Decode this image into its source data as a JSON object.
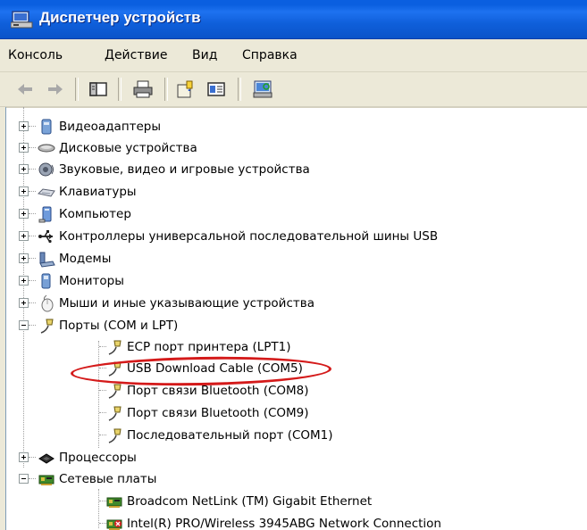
{
  "window": {
    "title": "Диспетчер устройств",
    "icon": "device-manager-icon"
  },
  "menu": {
    "items": [
      "Консоль",
      "Действие",
      "Вид",
      "Справка"
    ]
  },
  "toolbar": {
    "buttons": [
      "back-arrow-icon",
      "forward-arrow-icon",
      "show-hide-tree-icon",
      "print-icon",
      "properties-help-icon",
      "properties-icon",
      "scan-hardware-icon"
    ]
  },
  "tree": {
    "categories": [
      {
        "label": "Видеоадаптеры",
        "icon": "display-adapter-icon"
      },
      {
        "label": "Дисковые устройства",
        "icon": "disk-drive-icon"
      },
      {
        "label": "Звуковые, видео и игровые устройства",
        "icon": "sound-device-icon"
      },
      {
        "label": "Клавиатуры",
        "icon": "keyboard-icon"
      },
      {
        "label": "Компьютер",
        "icon": "computer-icon"
      },
      {
        "label": "Контроллеры универсальной последовательной шины USB",
        "icon": "usb-icon"
      },
      {
        "label": "Модемы",
        "icon": "modem-icon"
      },
      {
        "label": "Мониторы",
        "icon": "monitor-icon"
      },
      {
        "label": "Мыши и иные указывающие устройства",
        "icon": "mouse-icon"
      },
      {
        "label": "Порты (COM и LPT)",
        "icon": "port-icon"
      },
      {
        "label": "Процессоры",
        "icon": "processor-icon"
      },
      {
        "label": "Сетевые платы",
        "icon": "network-card-icon"
      }
    ],
    "ports": [
      "ECP порт принтера (LPT1)",
      "USB Download Cable (COM5)",
      "Порт связи Bluetooth (COM8)",
      "Порт связи Bluetooth (COM9)",
      "Последовательный порт (COM1)"
    ],
    "network_cards": [
      "Broadcom NetLink (TM) Gigabit Ethernet",
      "Intel(R) PRO/Wireless 3945ABG Network Connection"
    ]
  },
  "colors": {
    "titlebar": "#0a5fe0",
    "menubar": "#ece9d8",
    "highlight_ellipse": "#d41a1a"
  }
}
